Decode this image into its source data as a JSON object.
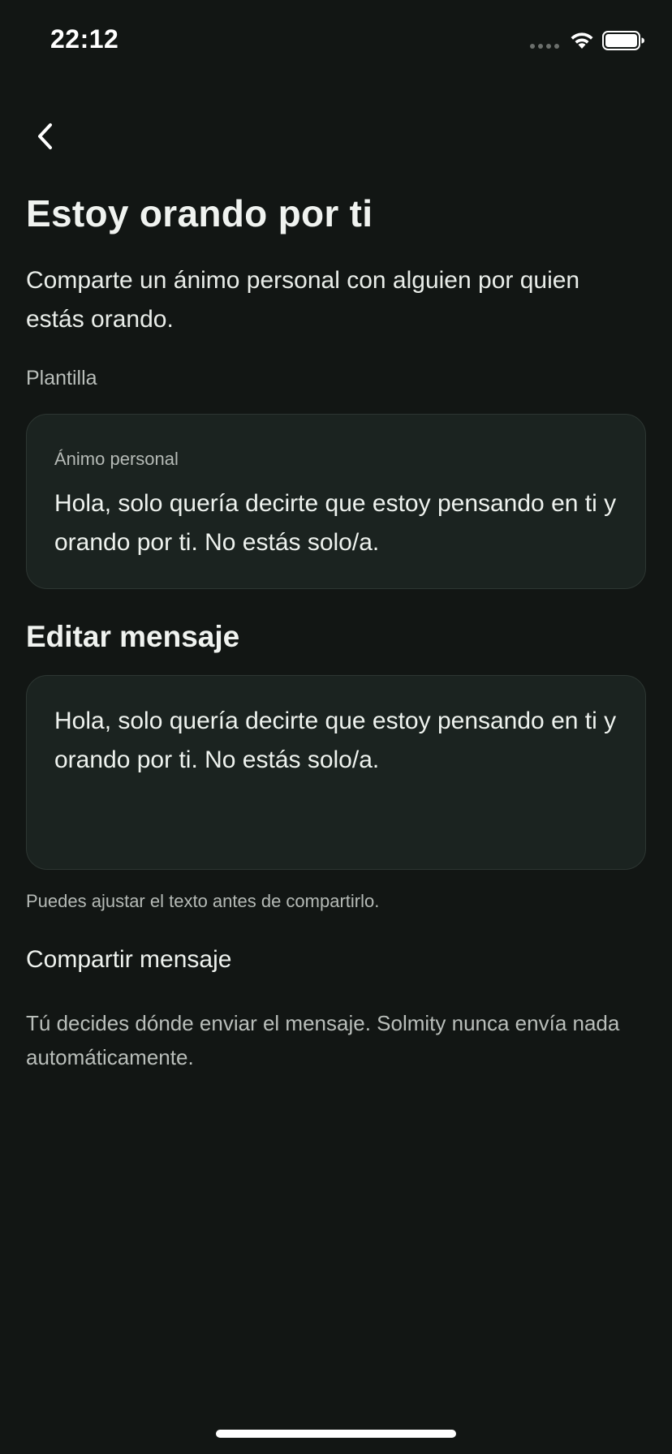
{
  "status_bar": {
    "time": "22:12"
  },
  "icons": {
    "back": "chevron-left-icon",
    "wifi": "wifi-icon",
    "battery": "battery-icon",
    "signal": "signal-icon"
  },
  "header": {
    "title": "Estoy orando por ti",
    "subtitle": "Comparte un ánimo personal con alguien por quien estás orando."
  },
  "template": {
    "section_label": "Plantilla",
    "card_label": "Ánimo personal",
    "card_text": "Hola, solo quería decirte que estoy pensando en ti y orando por ti. No estás solo/a."
  },
  "editor": {
    "heading": "Editar mensaje",
    "value": "Hola, solo quería decirte que estoy pensando en ti y orando por ti. No estás solo/a.",
    "hint": "Puedes ajustar el texto antes de compartirlo."
  },
  "share": {
    "heading": "Compartir mensaje",
    "body": "Tú decides dónde enviar el mensaje. Solmity nunca envía nada automáticamente."
  },
  "colors": {
    "background": "#121614",
    "card": "#1b2320",
    "card_border": "#2d3632",
    "text_primary": "#eef2ee",
    "text_secondary": "#b5bab6"
  }
}
